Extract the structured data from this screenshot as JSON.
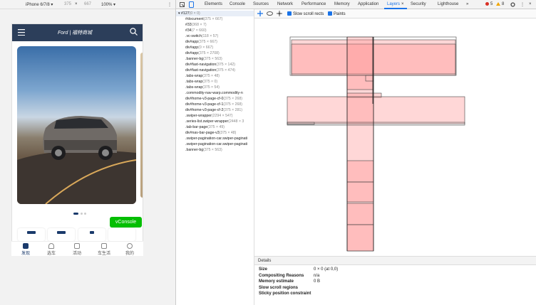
{
  "device_toolbar": {
    "device": "iPhone 6/7/8 ▾",
    "width": "375",
    "x": "×",
    "height": "667",
    "zoom": "100% ▾",
    "more": "⋮"
  },
  "phone": {
    "brand": "Ford | 福特商城",
    "tabs": [
      {
        "label": "发现"
      },
      {
        "label": "选车"
      },
      {
        "label": "活动"
      },
      {
        "label": "车生活"
      },
      {
        "label": "我的"
      }
    ],
    "vconsole": "vConsole"
  },
  "devtools": {
    "tabs": [
      "Elements",
      "Console",
      "Sources",
      "Network",
      "Performance",
      "Memory",
      "Application",
      "Layers",
      "Security",
      "Lighthouse",
      "»"
    ],
    "active_tab": "Layers",
    "close": "×",
    "errors": "5",
    "warnings": "8"
  },
  "layer_tree": [
    {
      "name": "▾ #127",
      "size": "(0 × 0)"
    },
    {
      "name": "#document",
      "size": "(375 × 667)"
    },
    {
      "name": "#33",
      "size": "(368 × 7)"
    },
    {
      "name": "#34",
      "size": "(7 × 660)"
    },
    {
      "name": ".vc-switch",
      "size": "(118 × 57)"
    },
    {
      "name": "div#app",
      "size": "(375 × 667)"
    },
    {
      "name": "div#app",
      "size": "(0 × 667)"
    },
    {
      "name": "div#app",
      "size": "(375 × 2708)"
    },
    {
      "name": ".banner-bg",
      "size": "(375 × 563)"
    },
    {
      "name": "div#fast-navigation",
      "size": "(375 × 142)"
    },
    {
      "name": "div#fast-navigation",
      "size": "(375 × 474)"
    },
    {
      "name": ".tabs-wrap",
      "size": "(375 × 48)"
    },
    {
      "name": ".tabs-wrap",
      "size": "(375 × 0)"
    },
    {
      "name": ".tabs-wrap",
      "size": "(375 × 54)"
    },
    {
      "name": ".commodity-nav-warp.commodity-n",
      "size": ""
    },
    {
      "name": "div#home-v3-page-cf-0",
      "size": "(375 × 268)"
    },
    {
      "name": "div#home-v3-page-cf-1",
      "size": "(375 × 268)"
    },
    {
      "name": "div#home-v3-page-cf-2",
      "size": "(375 × 281)"
    },
    {
      "name": ".swiper-wrapper",
      "size": "(2294 × 547)"
    },
    {
      "name": ".series-list.swiper-wrapper",
      "size": "(2448 × 3"
    },
    {
      "name": ".tab-bar-page",
      "size": "(375 × 49)"
    },
    {
      "name": "div#nav-bar-page-v3",
      "size": "(375 × 48)"
    },
    {
      "name": ".swiper-pagination-car.swiper-paginati",
      "size": ""
    },
    {
      "name": ".swiper-pagination-car.swiper-paginati",
      "size": ""
    },
    {
      "name": ".banner-bg",
      "size": "(375 × 563)"
    }
  ],
  "layers_toolbar": {
    "slow_scroll": "Slow scroll rects",
    "paints": "Paints"
  },
  "details": {
    "tab": "Details",
    "rows": [
      {
        "key": "Size",
        "value": "0 × 0 (at 0,0)"
      },
      {
        "key": "Compositing Reasons",
        "value": "n/a"
      },
      {
        "key": "Memory estimate",
        "value": "0 B"
      },
      {
        "key": "Slow scroll regions",
        "value": ""
      },
      {
        "key": "Sticky position constraint",
        "value": ""
      }
    ]
  }
}
